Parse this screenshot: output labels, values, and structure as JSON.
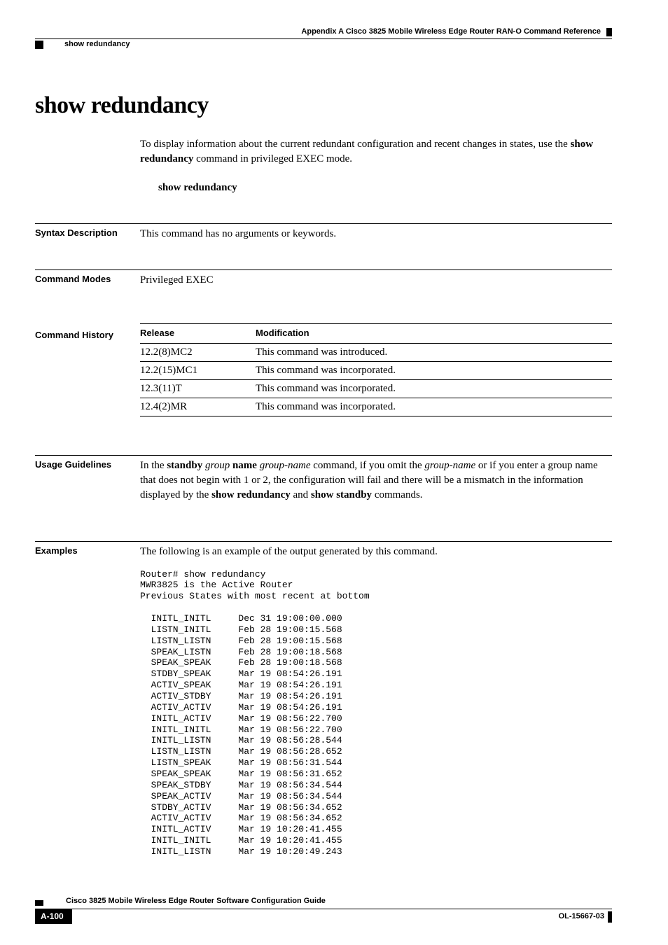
{
  "header": {
    "appendix": "Appendix A      Cisco 3825 Mobile Wireless Edge Router RAN-O Command Reference",
    "section": "show redundancy"
  },
  "title": "show redundancy",
  "intro": {
    "prefix": "To display information about the current redundant configuration and recent changes in states, use the ",
    "bold": "show redundancy",
    "suffix": " command in privileged EXEC mode."
  },
  "syntax_cmd": "show redundancy",
  "syntax_description": {
    "label": "Syntax Description",
    "text": "This command has no arguments or keywords."
  },
  "command_modes": {
    "label": "Command Modes",
    "text": "Privileged EXEC"
  },
  "command_history": {
    "label": "Command History",
    "col1": "Release",
    "col2": "Modification",
    "rows": [
      {
        "release": "12.2(8)MC2",
        "modification": "This command was introduced."
      },
      {
        "release": "12.2(15)MC1",
        "modification": "This command was incorporated."
      },
      {
        "release": "12.3(11)T",
        "modification": "This command was incorporated."
      },
      {
        "release": "12.4(2)MR",
        "modification": "This command was incorporated."
      }
    ]
  },
  "usage_guidelines": {
    "label": "Usage Guidelines",
    "p1": "In the ",
    "b1": "standby ",
    "i1": "group ",
    "b2": "name ",
    "i2": "group-name",
    "p2": " command, if you omit the ",
    "i3": "group-name",
    "p3": " or if you enter a group name that does not begin with 1 or 2, the configuration will fail and there will be a mismatch in the information displayed by the ",
    "b3": "show redundancy",
    "p4": " and ",
    "b4": "show standby",
    "p5": " commands."
  },
  "examples": {
    "label": "Examples",
    "intro": "The following is an example of the output generated by this command.",
    "output": "Router# show redundancy\nMWR3825 is the Active Router\nPrevious States with most recent at bottom\n\n  INITL_INITL     Dec 31 19:00:00.000\n  LISTN_INITL     Feb 28 19:00:15.568\n  LISTN_LISTN     Feb 28 19:00:15.568\n  SPEAK_LISTN     Feb 28 19:00:18.568\n  SPEAK_SPEAK     Feb 28 19:00:18.568\n  STDBY_SPEAK     Mar 19 08:54:26.191\n  ACTIV_SPEAK     Mar 19 08:54:26.191\n  ACTIV_STDBY     Mar 19 08:54:26.191\n  ACTIV_ACTIV     Mar 19 08:54:26.191\n  INITL_ACTIV     Mar 19 08:56:22.700\n  INITL_INITL     Mar 19 08:56:22.700\n  INITL_LISTN     Mar 19 08:56:28.544\n  LISTN_LISTN     Mar 19 08:56:28.652\n  LISTN_SPEAK     Mar 19 08:56:31.544\n  SPEAK_SPEAK     Mar 19 08:56:31.652\n  SPEAK_STDBY     Mar 19 08:56:34.544\n  SPEAK_ACTIV     Mar 19 08:56:34.544\n  STDBY_ACTIV     Mar 19 08:56:34.652\n  ACTIV_ACTIV     Mar 19 08:56:34.652\n  INITL_ACTIV     Mar 19 10:20:41.455\n  INITL_INITL     Mar 19 10:20:41.455\n  INITL_LISTN     Mar 19 10:20:49.243"
  },
  "footer": {
    "guide": "Cisco 3825 Mobile Wireless Edge Router Software Configuration Guide",
    "page": "A-100",
    "code": "OL-15667-03"
  }
}
